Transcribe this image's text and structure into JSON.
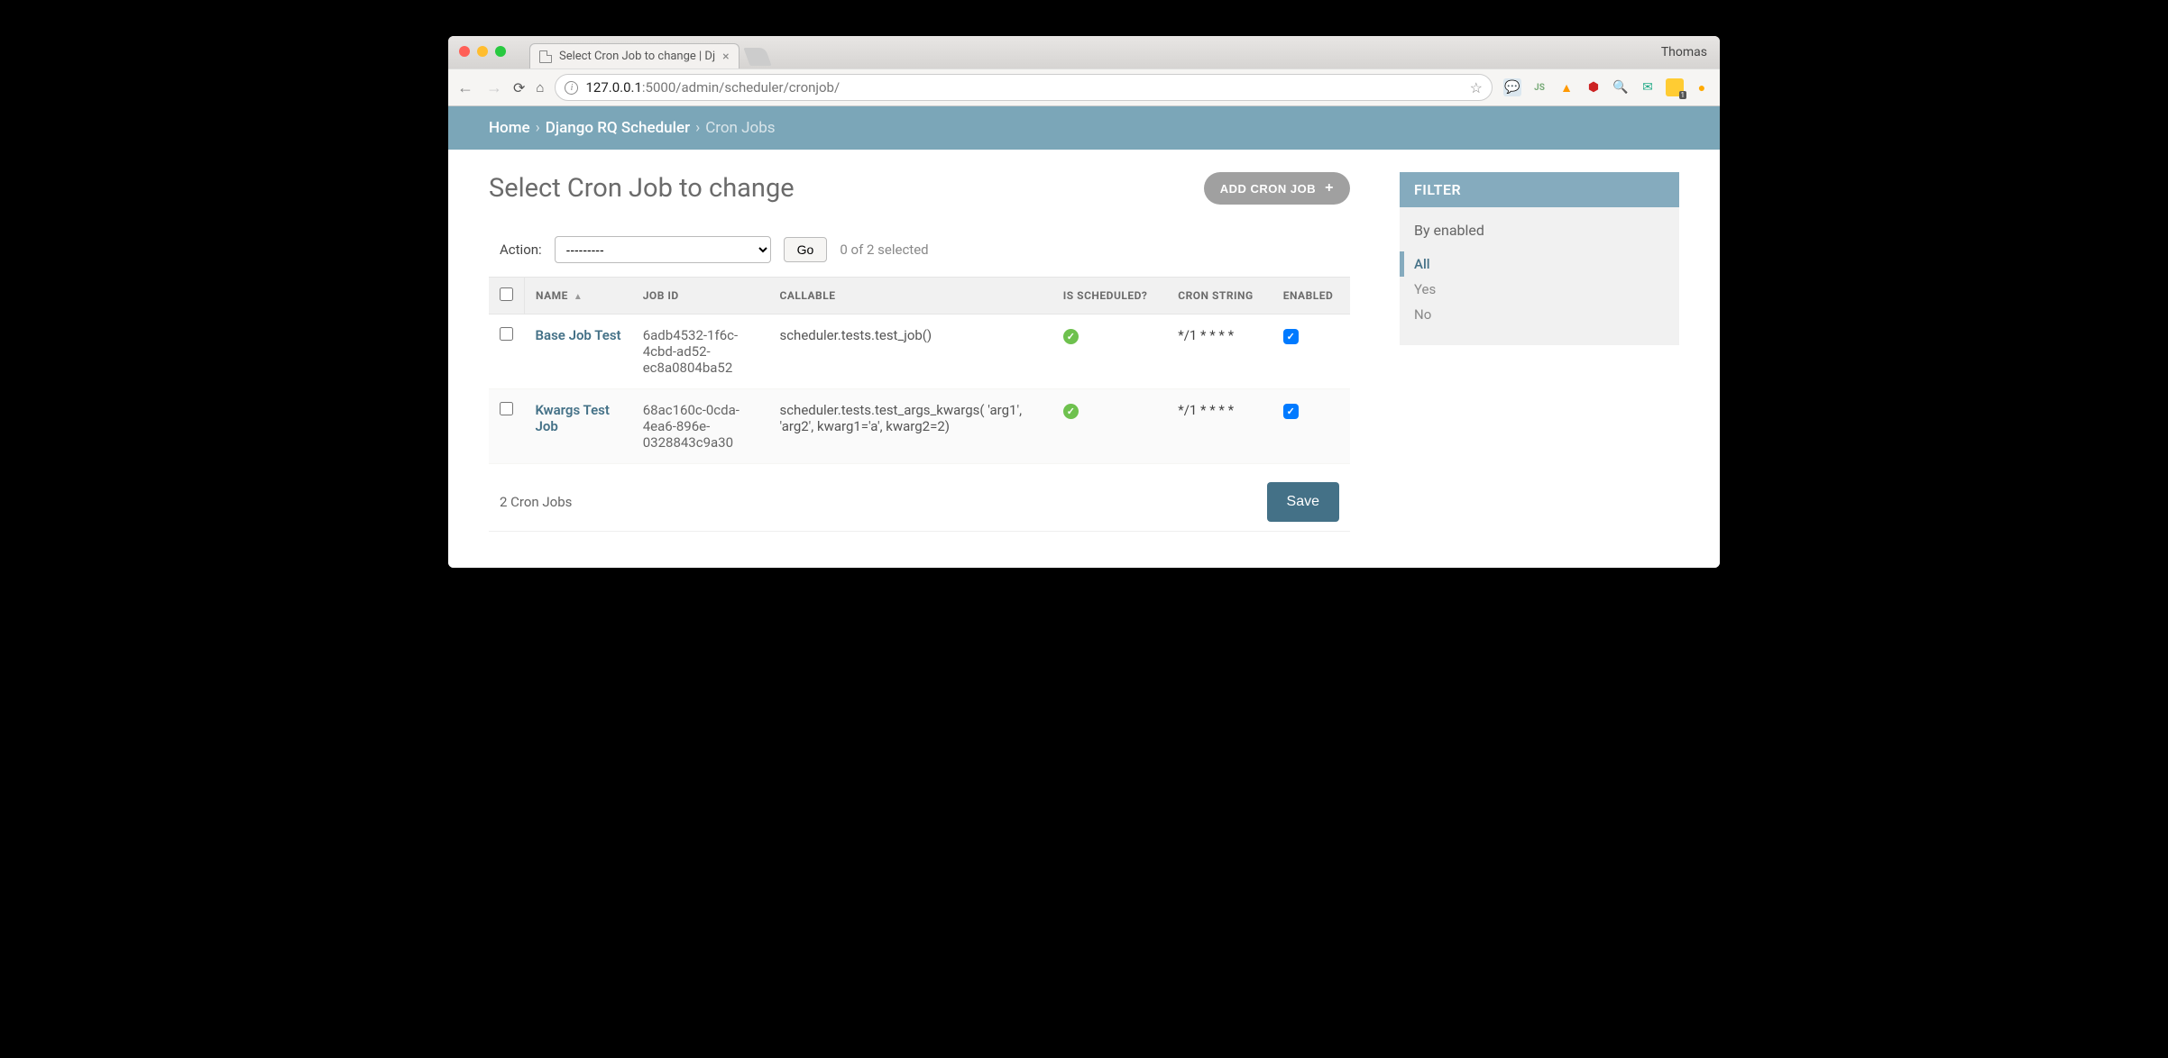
{
  "browser": {
    "tab_title": "Select Cron Job to change | Dj",
    "profile": "Thomas",
    "url_host": "127.0.0.1",
    "url_port": ":5000",
    "url_path": "/admin/scheduler/cronjob/"
  },
  "breadcrumb": {
    "home": "Home",
    "app": "Django RQ Scheduler",
    "current": "Cron Jobs"
  },
  "page_title": "Select Cron Job to change",
  "add_button": "ADD CRON JOB",
  "action_bar": {
    "label": "Action:",
    "placeholder": "---------",
    "go": "Go",
    "selection": "0 of 2 selected"
  },
  "columns": {
    "name": "NAME",
    "job_id": "JOB ID",
    "callable": "CALLABLE",
    "scheduled": "IS SCHEDULED?",
    "cron": "CRON STRING",
    "enabled": "ENABLED"
  },
  "rows": [
    {
      "name": "Base Job Test",
      "job_id": "6adb4532-1f6c-4cbd-ad52-ec8a0804ba52",
      "callable": "scheduler.tests.test_job()",
      "scheduled": true,
      "cron": "*/1 * * * *",
      "enabled": true
    },
    {
      "name": "Kwargs Test Job",
      "job_id": "68ac160c-0cda-4ea6-896e-0328843c9a30",
      "callable": "scheduler.tests.test_args_kwargs( 'arg1', 'arg2', kwarg1='a', kwarg2=2)",
      "scheduled": true,
      "cron": "*/1 * * * *",
      "enabled": true
    }
  ],
  "footer": {
    "count": "2 Cron Jobs",
    "save": "Save"
  },
  "filter": {
    "title": "FILTER",
    "by": "By enabled",
    "options": [
      "All",
      "Yes",
      "No"
    ],
    "selected": "All"
  }
}
